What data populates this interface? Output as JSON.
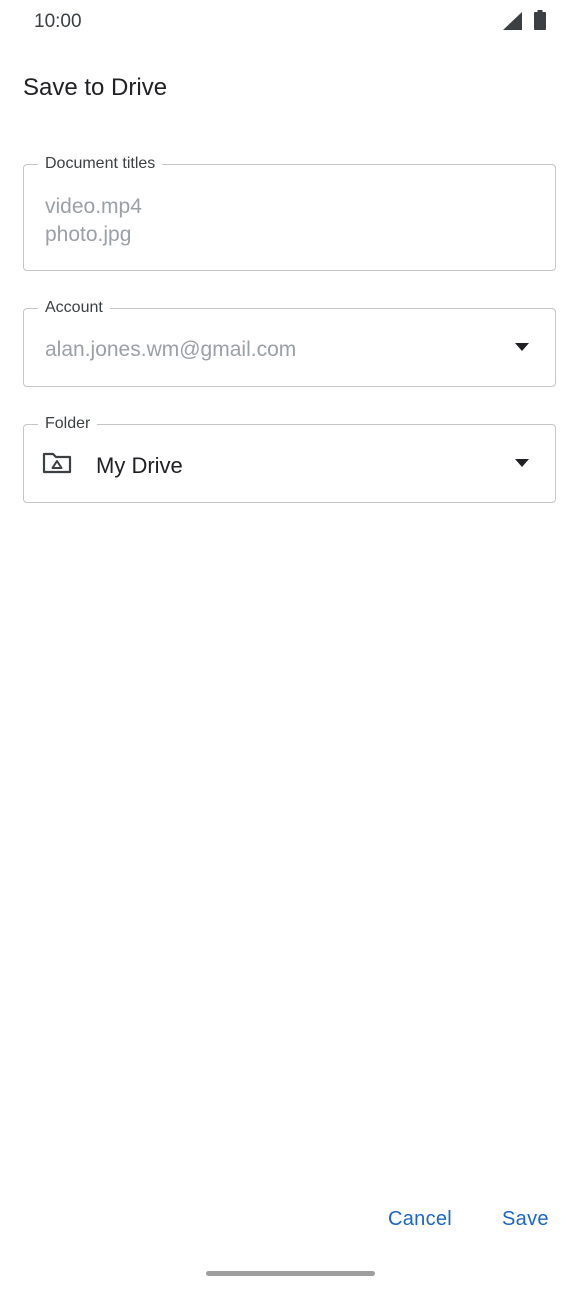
{
  "status_bar": {
    "time": "10:00",
    "icons": [
      "signal-icon",
      "battery-icon"
    ]
  },
  "header": {
    "title": "Save to Drive"
  },
  "form": {
    "document_titles": {
      "label": "Document titles",
      "values": [
        "video.mp4",
        "photo.jpg"
      ]
    },
    "account": {
      "label": "Account",
      "value": "alan.jones.wm@gmail.com"
    },
    "folder": {
      "label": "Folder",
      "value": "My Drive",
      "icon": "drive-folder-icon"
    }
  },
  "actions": {
    "cancel_label": "Cancel",
    "save_label": "Save"
  },
  "colors": {
    "accent": "#1a66c9",
    "outline": "#c4c7c5",
    "hint_text": "#9aa0a6"
  }
}
